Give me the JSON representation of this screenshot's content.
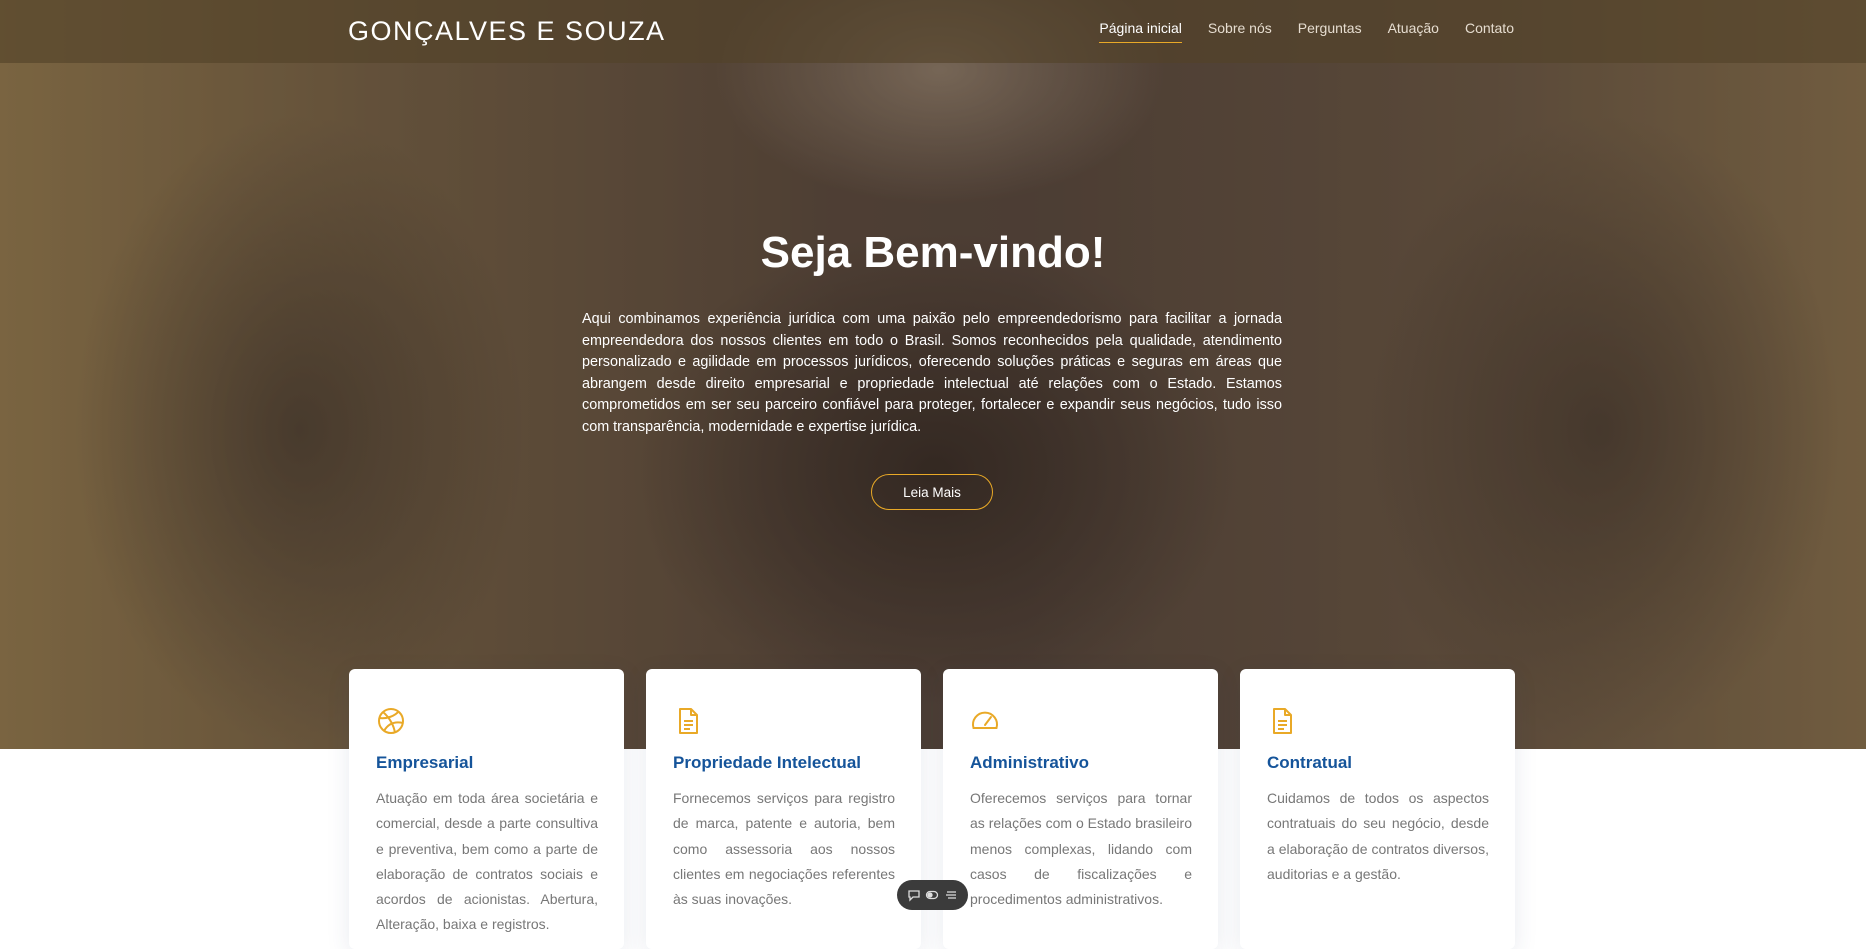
{
  "header": {
    "logo": "GONÇALVES E SOUZA",
    "nav": [
      {
        "label": "Página inicial",
        "active": true
      },
      {
        "label": "Sobre nós"
      },
      {
        "label": "Perguntas"
      },
      {
        "label": "Atuação"
      },
      {
        "label": "Contato"
      }
    ]
  },
  "hero": {
    "title": "Seja Bem-vindo!",
    "text": "Aqui combinamos experiência jurídica com uma paixão pelo empreendedorismo para facilitar a jornada empreendedora dos nossos clientes em todo o Brasil. Somos reconhecidos pela qualidade, atendimento personalizado e agilidade em processos jurídicos, oferecendo soluções práticas e seguras em áreas que abrangem desde direito empresarial e propriedade intelectual até relações com o Estado. Estamos comprometidos em ser seu parceiro confiável para proteger, fortalecer e expandir seus negócios, tudo isso com transparência, modernidade e expertise jurídica.",
    "button": "Leia Mais"
  },
  "services": [
    {
      "icon": "dribbble-icon",
      "title": "Empresarial",
      "text": "Atuação em toda área societária e comercial, desde a parte consultiva e preventiva, bem como a parte de elaboração de contratos sociais e acordos de acionistas. Abertura, Alteração, baixa e registros."
    },
    {
      "icon": "document-icon",
      "title": "Propriedade Intelectual",
      "text": "Fornecemos serviços para registro de marca, patente e autoria, bem como assessoria aos nossos clientes em negociações referentes às suas inovações."
    },
    {
      "icon": "speedometer-icon",
      "title": "Administrativo",
      "text": "Oferecemos serviços para tornar as relações com o Estado brasileiro menos complexas, lidando com casos de fiscalizações e procedimentos administrativos."
    },
    {
      "icon": "document-icon",
      "title": "Contratual",
      "text": "Cuidamos de todos os aspectos contratuais do seu negócio, desde a elaboração de contratos diversos, auditorias e a gestão."
    }
  ],
  "colors": {
    "accent": "#e9a927",
    "card_title": "#15549a",
    "card_text": "#777777"
  }
}
